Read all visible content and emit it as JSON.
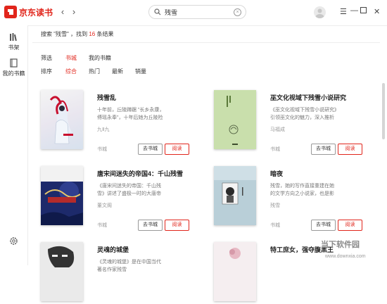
{
  "app": {
    "name": "京东读书"
  },
  "search": {
    "value": "残雪"
  },
  "sidebar": {
    "items": [
      {
        "label": "书架"
      },
      {
        "label": "我的书籍"
      }
    ]
  },
  "results": {
    "prefix": "搜索 \"残雪\" ，找到 ",
    "count": "16",
    "suffix": " 条结果"
  },
  "filters": {
    "filter_label": "筛选",
    "filter_options": [
      {
        "label": "书城",
        "active": true
      },
      {
        "label": "我的书籍",
        "active": false
      }
    ],
    "sort_label": "排序",
    "sort_options": [
      {
        "label": "综合",
        "active": true
      },
      {
        "label": "热门",
        "active": false
      },
      {
        "label": "最新",
        "active": false
      },
      {
        "label": "销量",
        "active": false
      }
    ]
  },
  "books": [
    {
      "title": "残雪乱",
      "desc": "十年前，丘陵蹲踞 \"长乡永康，傅瑶永奉\"，十年后她为丘陵险食，漏盘而鸣。",
      "author": "九Ⅱ九",
      "source": "书城",
      "store_label": "去书城",
      "read_label": "阅读"
    },
    {
      "title": "巫文化视域下残雪小说研究",
      "desc": "《巫文化视域下残雪小说研究》引领巫文化的魅力，深入推析人类学家卡夫卡卡斯...",
      "author": "马福成",
      "source": "书城",
      "store_label": "去书城",
      "read_label": "阅读"
    },
    {
      "title": "唐宋间迷失的帝国4：千山残雪",
      "desc": "《唐宋间迷失的帝国：千山残雪》讲述了盛极一时的大唐帝国衰败崩溃后，各种社会...",
      "author": "董文阁",
      "source": "书城",
      "store_label": "去书城",
      "read_label": "阅读"
    },
    {
      "title": "暗夜",
      "desc": "残雪，她的写作直接重建在她的文学方向之小说家，也是影响广泛的先锋小说家。",
      "author": "残雪",
      "source": "书城",
      "store_label": "去书城",
      "read_label": "阅读"
    },
    {
      "title": "灵魂的城堡",
      "desc": "《灵魂的城堡》是在中国当代著名作家残雪",
      "author": "",
      "source": "",
      "store_label": "",
      "read_label": ""
    },
    {
      "title": "特工庶女，强夺腹黑王",
      "desc": "",
      "author": "",
      "source": "",
      "store_label": "",
      "read_label": ""
    }
  ],
  "watermark": {
    "text": "当下软件园",
    "sub": "www.downxia.com"
  }
}
